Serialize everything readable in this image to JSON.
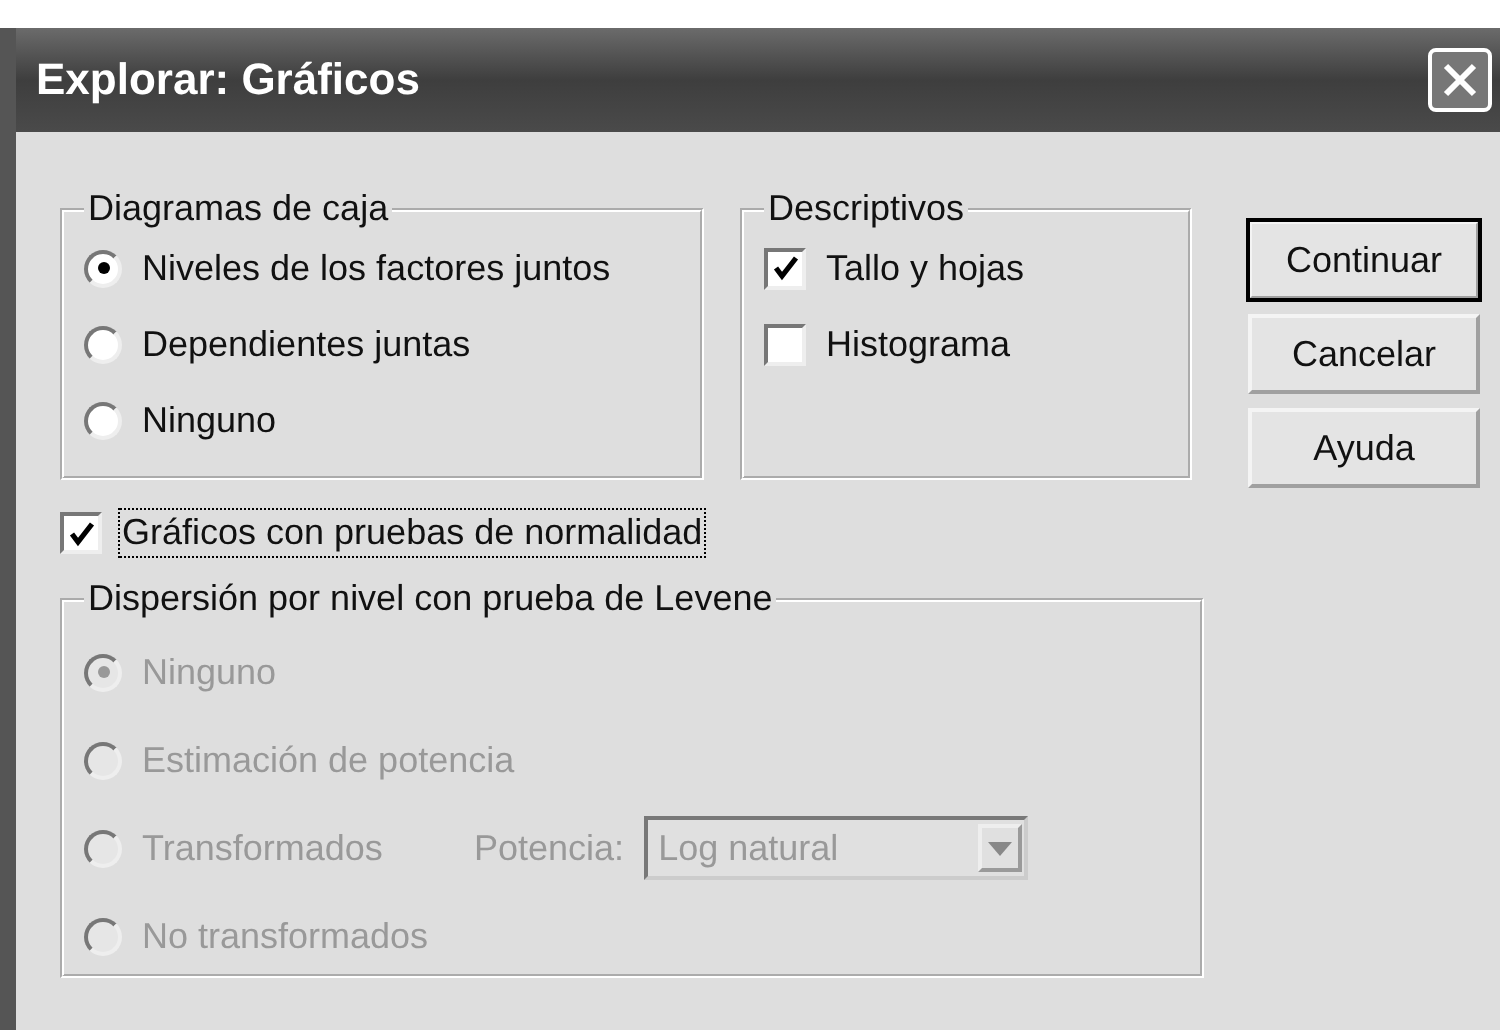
{
  "window": {
    "title": "Explorar: Gráficos"
  },
  "box_plots": {
    "label": "Diagramas de caja",
    "options": [
      {
        "label": "Niveles de los factores juntos",
        "selected": true
      },
      {
        "label": "Dependientes juntas",
        "selected": false
      },
      {
        "label": "Ninguno",
        "selected": false
      }
    ]
  },
  "descriptives": {
    "label": "Descriptivos",
    "items": [
      {
        "label": "Tallo y hojas",
        "checked": true
      },
      {
        "label": "Histograma",
        "checked": false
      }
    ]
  },
  "buttons": [
    {
      "label": "Continuar",
      "default": true
    },
    {
      "label": "Cancelar",
      "default": false
    },
    {
      "label": "Ayuda",
      "default": false
    }
  ],
  "normality": {
    "label": "Gráficos con pruebas de normalidad",
    "checked": true,
    "focused": true
  },
  "levene": {
    "label": "Dispersión por nivel con prueba de Levene",
    "disabled": true,
    "options": [
      {
        "label": "Ninguno",
        "selected": true,
        "kind": "radio"
      },
      {
        "label": "Estimación de potencia",
        "selected": false,
        "kind": "radio"
      },
      {
        "label": "Transformados",
        "selected": false,
        "kind": "radio_with_power"
      },
      {
        "label": "No transformados",
        "selected": false,
        "kind": "radio"
      }
    ],
    "power": {
      "label": "Potencia:",
      "value": "Log natural"
    }
  }
}
